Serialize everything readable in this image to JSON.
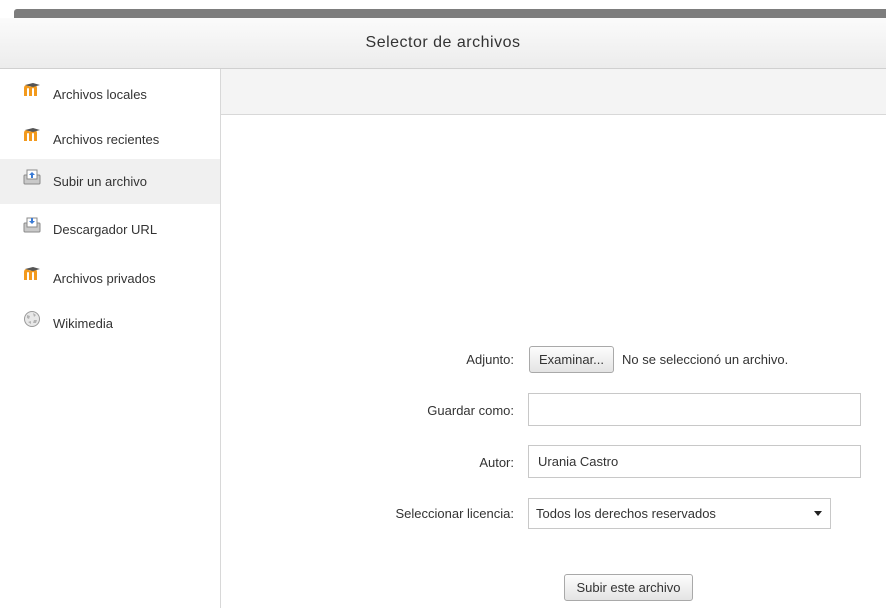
{
  "dialog": {
    "title": "Selector de archivos"
  },
  "sidebar": {
    "items": [
      {
        "label": "Archivos locales",
        "icon": "moodle-icon"
      },
      {
        "label": "Archivos recientes",
        "icon": "moodle-icon"
      },
      {
        "label": "Subir un archivo",
        "icon": "upload-icon",
        "active": true
      },
      {
        "label": "Descargador URL",
        "icon": "download-url-icon"
      },
      {
        "label": "Archivos privados",
        "icon": "moodle-icon"
      },
      {
        "label": "Wikimedia",
        "icon": "wikimedia-icon"
      }
    ]
  },
  "form": {
    "attachment": {
      "label": "Adjunto:",
      "button": "Examinar...",
      "status": "No se seleccionó un archivo."
    },
    "save_as": {
      "label": "Guardar como:",
      "value": ""
    },
    "author": {
      "label": "Autor:",
      "value": "Urania Castro"
    },
    "license": {
      "label": "Seleccionar licencia:",
      "selected": "Todos los derechos reservados"
    },
    "submit": "Subir este archivo"
  },
  "colors": {
    "moodle_orange": "#f39a1d",
    "active_bg": "#f0f0f0",
    "border": "#c8c8c8"
  }
}
